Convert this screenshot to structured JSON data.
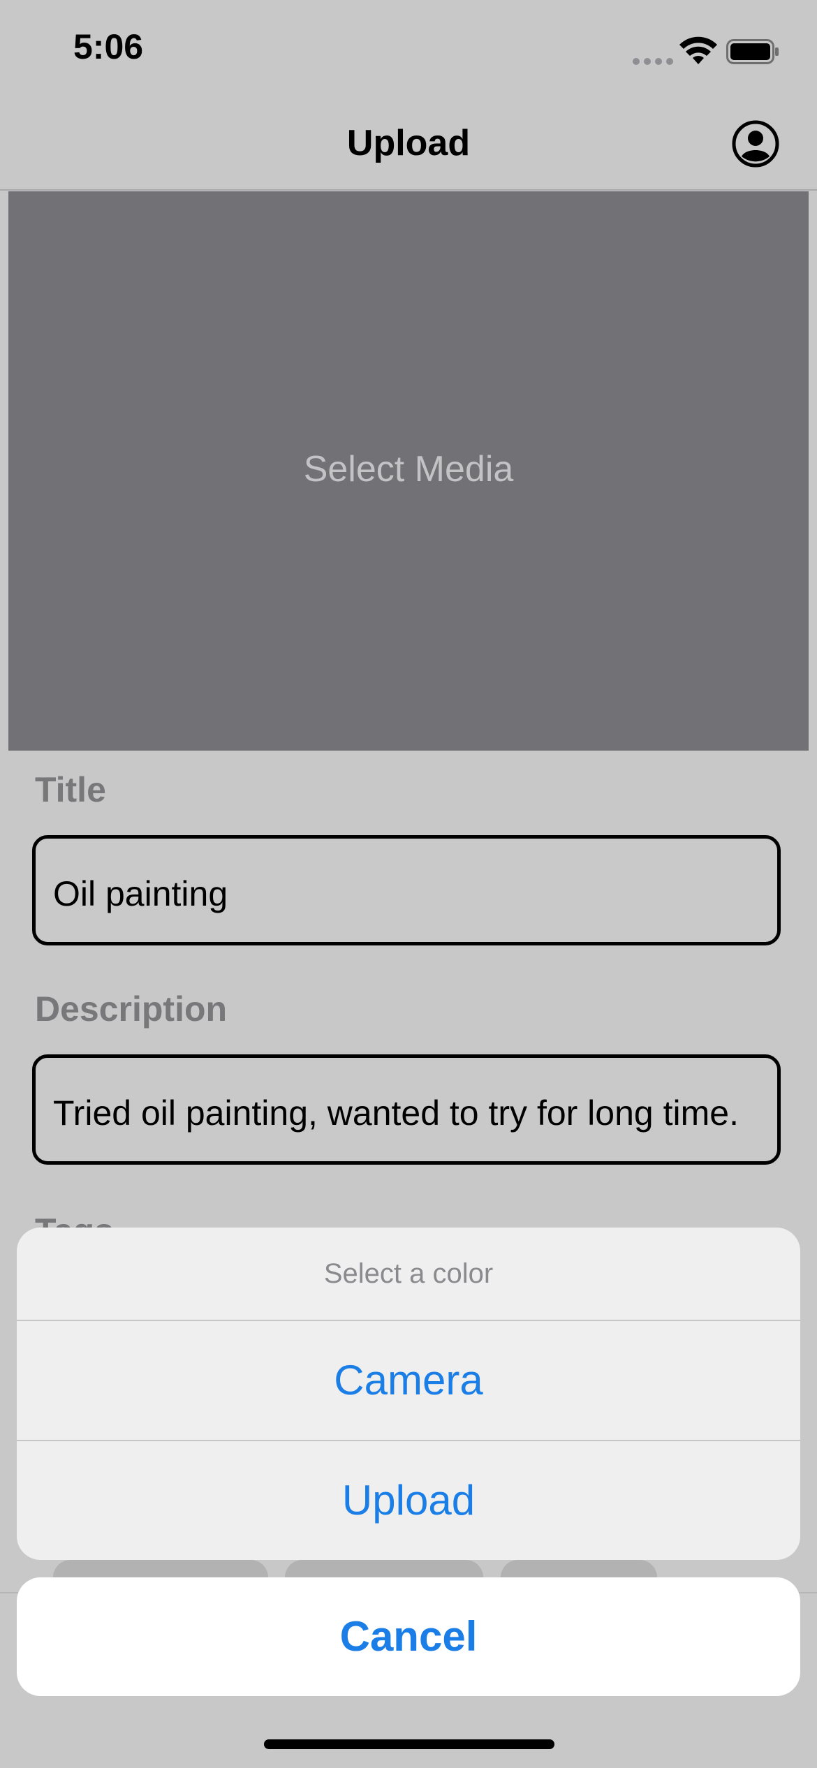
{
  "status_bar": {
    "time": "5:06",
    "icons": [
      "signal-icon",
      "wifi-icon",
      "battery-icon"
    ]
  },
  "nav": {
    "title": "Upload",
    "right_icon": "person-circle-icon"
  },
  "media": {
    "label": "Select Media"
  },
  "form": {
    "title_label": "Title",
    "title_value": "Oil painting",
    "description_label": "Description",
    "description_value": "Tried oil painting, wanted to try for long time.",
    "tags_label": "Tags"
  },
  "action_sheet": {
    "header": "Select a color",
    "actions": [
      "Camera",
      "Upload"
    ],
    "cancel": "Cancel"
  },
  "colors": {
    "accent": "#1a7ee6",
    "backdrop": "#c8c8c8",
    "media_background": "#727276"
  }
}
